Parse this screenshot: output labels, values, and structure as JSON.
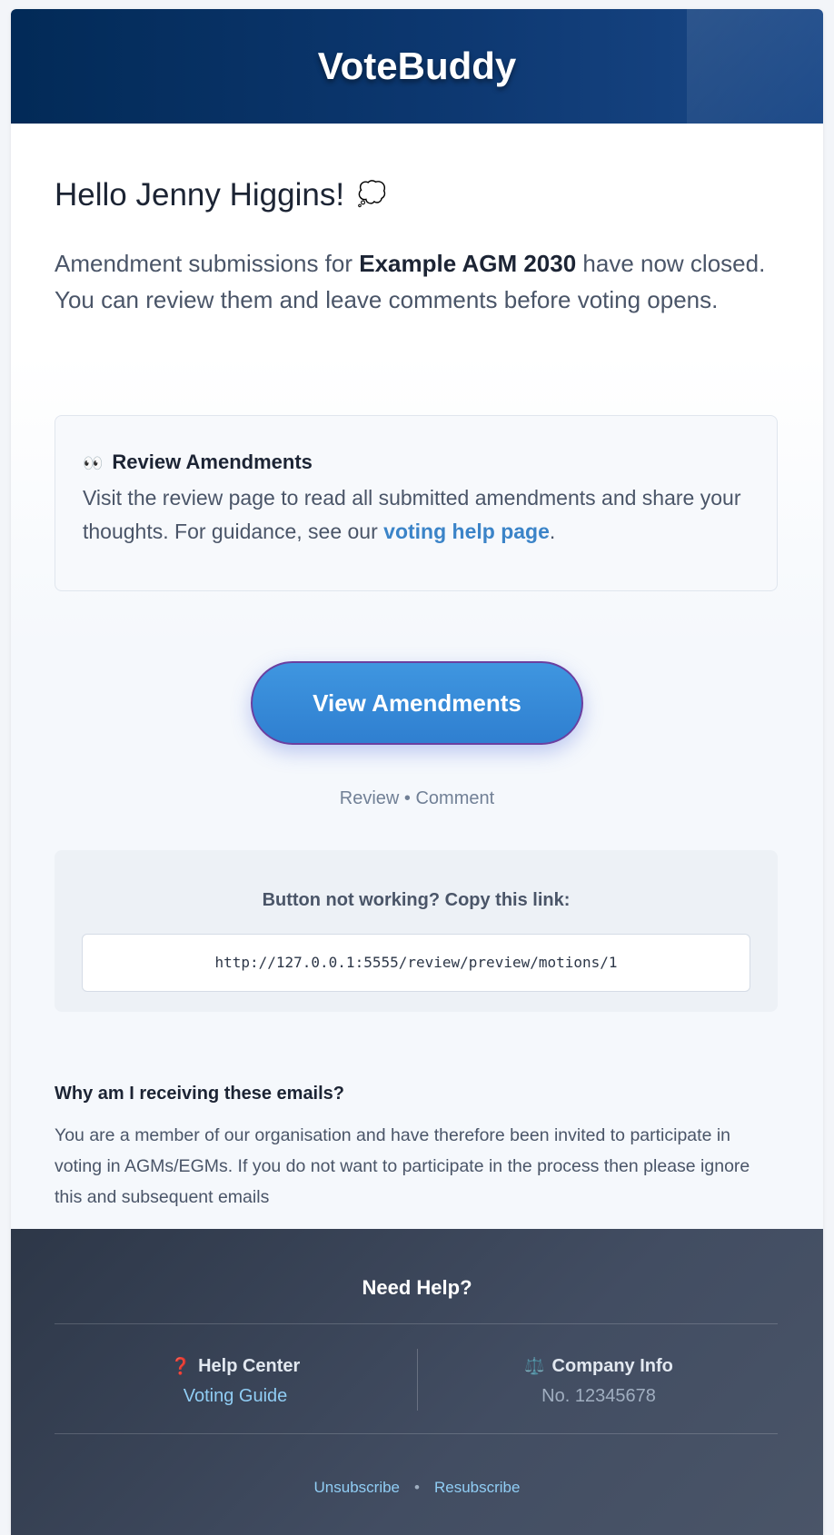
{
  "header": {
    "brand": "VoteBuddy"
  },
  "greeting": {
    "text": "Hello Jenny Higgins!",
    "icon": "speech-bubble-icon",
    "icon_glyph": "💭"
  },
  "intro": {
    "prefix": "Amendment submissions for ",
    "event_name": "Example AGM 2030",
    "suffix": " have now closed. You can review them and leave comments before voting opens."
  },
  "review_box": {
    "icon": "eyes-icon",
    "icon_glyph": "👀",
    "title": "Review Amendments",
    "text_prefix": "Visit the review page to read all submitted amendments and share your thoughts. For guidance, see our ",
    "link_label": "voting help page",
    "text_suffix": "."
  },
  "cta": {
    "button_label": "View Amendments",
    "subtext": "Review • Comment"
  },
  "fallback": {
    "title": "Button not working? Copy this link:",
    "url": "http://127.0.0.1:5555/review/preview/motions/1"
  },
  "why": {
    "title": "Why am I receiving these emails?",
    "text": "You are a member of our organisation and have therefore been invited to participate in voting in AGMs/EGMs. If you do not want to participate in the process then please ignore this and subsequent emails"
  },
  "footer": {
    "title": "Need Help?",
    "help_center": {
      "icon": "question-mark-icon",
      "icon_glyph": "❓",
      "label": "Help Center",
      "link_label": "Voting Guide"
    },
    "company_info": {
      "icon": "scales-icon",
      "icon_glyph": "⚖️",
      "label": "Company Info",
      "value": "No. 12345678"
    },
    "unsubscribe_label": "Unsubscribe",
    "separator": "•",
    "resubscribe_label": "Resubscribe"
  },
  "colors": {
    "header_start": "#022a57",
    "header_end": "#1a4888",
    "accent_link": "#3b84c8",
    "button_blue": "#3f96e0",
    "button_border": "#6b3fa0",
    "footer_bg": "#2d3748",
    "footer_link": "#90cdf4"
  }
}
